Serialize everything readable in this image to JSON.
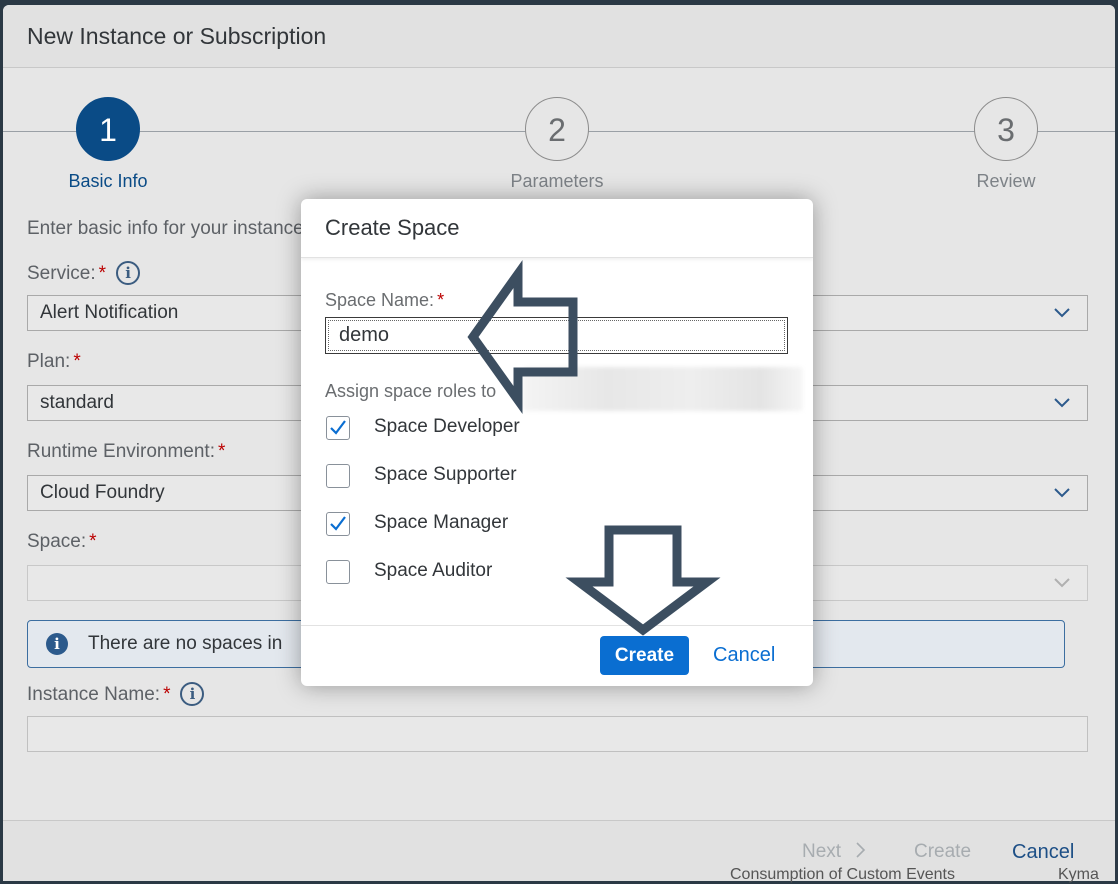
{
  "outer_dialog": {
    "title": "New Instance or Subscription",
    "steps": [
      {
        "number": "1",
        "label": "Basic Info"
      },
      {
        "number": "2",
        "label": "Parameters"
      },
      {
        "number": "3",
        "label": "Review"
      }
    ],
    "intro": "Enter basic info for your instance",
    "service": {
      "label": "Service:",
      "value": "Alert Notification"
    },
    "plan": {
      "label": "Plan:",
      "value": "standard"
    },
    "runtime": {
      "label": "Runtime Environment:",
      "value": "Cloud Foundry"
    },
    "space": {
      "label": "Space:",
      "value": ""
    },
    "info_message": "There are no spaces in",
    "instance_name": {
      "label": "Instance Name:",
      "value": ""
    },
    "footer": {
      "next": "Next",
      "create": "Create",
      "cancel": "Cancel"
    },
    "background_text": "Consumption of Custom Events",
    "background_text_right": "Kyma"
  },
  "modal": {
    "title": "Create Space",
    "space_name_label": "Space Name:",
    "space_name_value": "demo",
    "assign_roles_label": "Assign space roles to",
    "roles": [
      {
        "label": "Space Developer",
        "checked": true
      },
      {
        "label": "Space Supporter",
        "checked": false
      },
      {
        "label": "Space Manager",
        "checked": true
      },
      {
        "label": "Space Auditor",
        "checked": false
      }
    ],
    "create_button": "Create",
    "cancel_button": "Cancel"
  },
  "required_marker": "*",
  "colors": {
    "primary": "#0a6ed1",
    "step_active": "#0a4b86",
    "annotation_arrow": "#3c4e60",
    "required": "#bb0000"
  },
  "icons": {
    "info": "info-icon",
    "chevron": "chevron-down-icon",
    "next": "chevron-right-icon",
    "check": "checkmark-icon",
    "annotation": "arrow-icon"
  }
}
